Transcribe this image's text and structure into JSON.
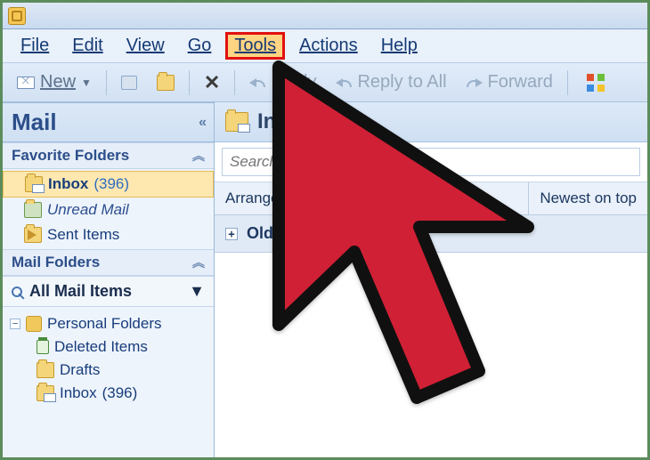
{
  "menubar": {
    "file": "File",
    "edit": "Edit",
    "view": "View",
    "go": "Go",
    "tools": "Tools",
    "actions": "Actions",
    "help": "Help"
  },
  "toolbar": {
    "new": "New",
    "reply": "Reply",
    "reply_all": "Reply to All",
    "forward": "Forward"
  },
  "nav": {
    "title": "Mail",
    "favorites_label": "Favorite Folders",
    "favorites": {
      "inbox_name": "Inbox",
      "inbox_count": "(396)",
      "unread": "Unread Mail",
      "sent": "Sent Items"
    },
    "mail_folders_label": "Mail Folders",
    "all_mail": "All Mail Items",
    "tree": {
      "root": "Personal Folders",
      "deleted": "Deleted Items",
      "drafts": "Drafts",
      "inbox_name": "Inbox",
      "inbox_count": "(396)"
    }
  },
  "content": {
    "folder_title": "Inbox",
    "search_placeholder": "Search Inbox",
    "arranged_by": "Arranged By: Date",
    "sort_right": "Newest on top",
    "group_older": "Older"
  }
}
